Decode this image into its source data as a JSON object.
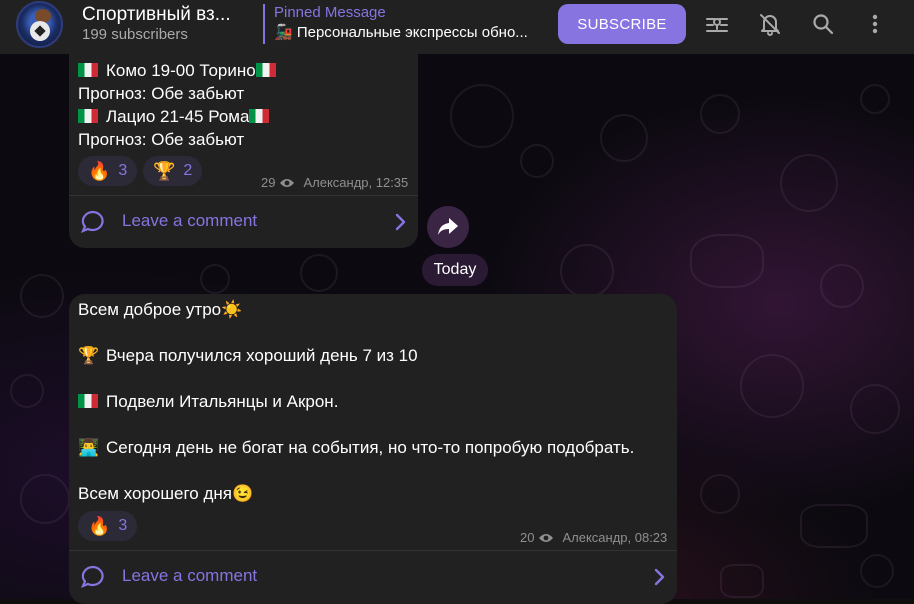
{
  "header": {
    "channel_title": "Спортивный вз...",
    "subscribers": "199 subscribers",
    "pinned_label": "Pinned Message",
    "pinned_text": "🚂 Персональные экспрессы обно...",
    "subscribe_label": "SUBSCRIBE",
    "icons": [
      "channel-avatar",
      "voice-chat-icon",
      "mute-bell-icon",
      "search-icon",
      "more-vertical-icon"
    ]
  },
  "messages": [
    {
      "lines": {
        "l1": "Комо 19-00 Торино",
        "l2": "Прогноз: Обе забьют",
        "l3": "Лацио 21-45 Рома",
        "l4": "Прогноз: Обе забьют"
      },
      "reactions": [
        {
          "emoji": "🔥",
          "count": "3"
        },
        {
          "emoji": "🏆",
          "count": "2"
        }
      ],
      "views": "29",
      "author_time": "Александр, 12:35",
      "comment_label": "Leave a comment"
    },
    {
      "lines": {
        "l1": "Всем доброе утро",
        "l1_emoji": "☀️",
        "l2_emoji": "🏆",
        "l2": "Вчера получился хороший день 7 из 10",
        "l3": "Подвели Итальянцы и Акрон.",
        "l4_emoji": "👨‍💻",
        "l4": "Сегодня день не богат на события, но что-то попробую подобрать.",
        "l5": "Всем хорошего дня",
        "l5_emoji": "😉"
      },
      "reactions": [
        {
          "emoji": "🔥",
          "count": "3"
        }
      ],
      "views": "20",
      "author_time": "Александр, 08:23",
      "comment_label": "Leave a comment"
    }
  ],
  "date_separator": "Today",
  "colors": {
    "accent": "#8774e1",
    "header_bg": "#212121",
    "bubble_bg": "#212121",
    "date_pill_bg": "#2b1a34"
  }
}
